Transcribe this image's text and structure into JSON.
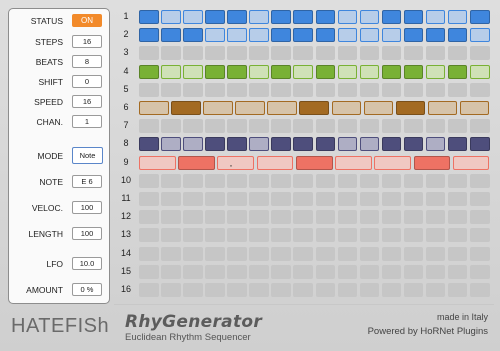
{
  "controls": [
    {
      "label": "STATUS",
      "value": "ON"
    },
    {
      "label": "STEPS",
      "value": "16"
    },
    {
      "label": "BEATS",
      "value": "8"
    },
    {
      "label": "SHIFT",
      "value": "0"
    },
    {
      "label": "SPEED",
      "value": "16"
    },
    {
      "label": "CHAN.",
      "value": "1"
    },
    {
      "label": "MODE",
      "value": "Note"
    },
    {
      "label": "NOTE",
      "value": "E 6"
    },
    {
      "label": "VELOC.",
      "value": "100"
    },
    {
      "label": "LENGTH",
      "value": "100"
    },
    {
      "label": "LFO",
      "value": "10.0"
    },
    {
      "label": "AMOUNT",
      "value": "0 %"
    }
  ],
  "rows": [
    {
      "num": "1",
      "count": 16,
      "on": [
        1,
        0,
        0,
        1,
        1,
        0,
        1,
        1,
        1,
        0,
        0,
        1,
        1,
        0,
        0,
        1
      ],
      "on_color": "#3f86dd",
      "off_color": "#b7cde9"
    },
    {
      "num": "2",
      "count": 16,
      "on": [
        1,
        1,
        1,
        0,
        0,
        0,
        1,
        1,
        1,
        0,
        0,
        0,
        1,
        1,
        1,
        0
      ],
      "on_color": "#3f86dd",
      "off_color": "#b7cde9"
    },
    {
      "num": "3",
      "count": 0,
      "on": []
    },
    {
      "num": "4",
      "count": 16,
      "on": [
        1,
        0,
        0,
        1,
        1,
        0,
        1,
        0,
        1,
        0,
        0,
        1,
        1,
        0,
        1,
        0
      ],
      "on_color": "#79b135",
      "off_color": "#cfe1b7"
    },
    {
      "num": "5",
      "count": 0,
      "on": []
    },
    {
      "num": "6",
      "count": 11,
      "on": [
        0,
        1,
        0,
        0,
        0,
        1,
        0,
        0,
        1,
        0,
        0
      ],
      "on_color": "#a36a22",
      "off_color": "#d6c3a9"
    },
    {
      "num": "7",
      "count": 0,
      "on": []
    },
    {
      "num": "8",
      "count": 16,
      "on": [
        1,
        0,
        0,
        1,
        1,
        0,
        1,
        1,
        1,
        0,
        0,
        1,
        1,
        0,
        1,
        1
      ],
      "on_color": "#4e4e7c",
      "off_color": "#aeaec4"
    },
    {
      "num": "9",
      "count": 9,
      "on": [
        0,
        1,
        0,
        0,
        1,
        0,
        0,
        1,
        0
      ],
      "on_color": "#ee7264",
      "off_color": "#f0c8c2"
    },
    {
      "num": "10",
      "count": 0,
      "on": []
    },
    {
      "num": "11",
      "count": 0,
      "on": []
    },
    {
      "num": "12",
      "count": 0,
      "on": []
    },
    {
      "num": "13",
      "count": 0,
      "on": []
    },
    {
      "num": "14",
      "count": 0,
      "on": []
    },
    {
      "num": "15",
      "count": 0,
      "on": []
    },
    {
      "num": "16",
      "count": 0,
      "on": []
    }
  ],
  "empty_cell_color": "#c6c6c6",
  "selected_row_cursor": "·",
  "footer": {
    "logo": "HATEFISh",
    "product": "RhyGenerator",
    "tagline": "Euclidean Rhythm Sequencer",
    "made": "made in Italy",
    "powered": "Powered by HoRNet Plugins"
  }
}
